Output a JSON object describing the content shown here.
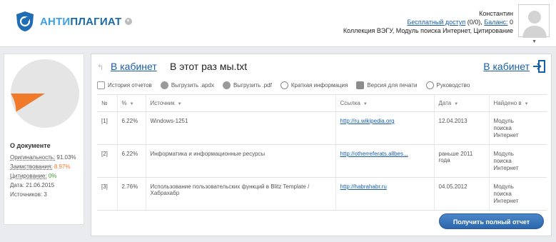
{
  "brand": {
    "part1": "АНТИ",
    "part2": "ПЛАГИАТ"
  },
  "user": {
    "name": "Константин",
    "free_access_label": "Бесплатный доступ",
    "free_access_value": "(0/0),",
    "balance_label": "Баланс:",
    "balance_value": "0",
    "collections": "Коллекция ВЭГУ, Модуль поиска Интернет, Цитирование"
  },
  "sidebar": {
    "title": "О документе",
    "originality_label": "Оригинальность:",
    "originality_value": "91.03%",
    "borrowing_label": "Заимствования:",
    "borrowing_value": "8.97%",
    "citation_label": "Цитирование:",
    "citation_value": "0%",
    "date_label": "Дата:",
    "date_value": "21.06.2015",
    "sources_label": "Источников:",
    "sources_value": "3",
    "pie": {
      "originality": 91.03,
      "borrowing": 8.97,
      "citation": 0
    }
  },
  "report": {
    "cabinet_link": "В кабинет",
    "title": "В этот раз мы.txt",
    "cabinet_right": "В кабинет"
  },
  "toolbar": {
    "history": "История отчетов",
    "export_apdx": "Выгрузить .apdx",
    "export_pdf": "Выгрузить .pdf",
    "brief": "Краткая информация",
    "print": "Версия для печати",
    "guide": "Руководство"
  },
  "table": {
    "headers": [
      "№",
      "%",
      "Источник",
      "Ссылка",
      "Дата",
      "Найдено в"
    ],
    "rows": [
      {
        "num": "[1]",
        "pct": "6.22%",
        "source": "Windows-1251",
        "link": "http://ru.wikipedia.org",
        "date": "12.04.2013",
        "found": [
          "Модуль",
          "поиска",
          "Интернет"
        ]
      },
      {
        "num": "[2]",
        "pct": "6.22%",
        "source": "Информатика и информационные ресурсы",
        "link": "http://otherreferats.allbes...",
        "date": "раньше 2011 года",
        "found": [
          "Модуль",
          "поиска",
          "Интернет"
        ]
      },
      {
        "num": "[3]",
        "pct": "2.76%",
        "source": "Использование пользовательских функций в Blitz Template / Хабрахабр",
        "link": "http://habrahabr.ru",
        "date": "04.05.2012",
        "found": [
          "Модуль",
          "поиска",
          "Интернет"
        ]
      }
    ]
  },
  "actions": {
    "full_report": "Получить полный отчет"
  },
  "colors": {
    "accent": "#1a5ea8",
    "brand_light": "#3aa0e6",
    "borrowing": "#f07a2a",
    "citation": "#3c9d2a"
  }
}
